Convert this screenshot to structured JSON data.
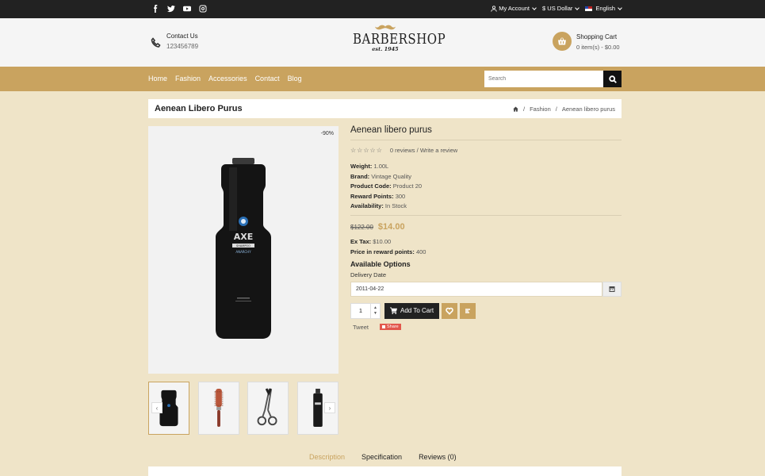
{
  "topbar": {
    "social_icons": [
      "facebook-icon",
      "twitter-icon",
      "youtube-icon",
      "instagram-icon"
    ],
    "my_account": "My Account",
    "currency": "$ US Dollar",
    "language": "English"
  },
  "header": {
    "contact_title": "Contact Us",
    "contact_phone": "123456789",
    "logo_name": "BARBERSHOP",
    "logo_est": "est. 1945",
    "cart_title": "Shopping Cart",
    "cart_summary": "0 item(s) - $0.00"
  },
  "nav": {
    "items": [
      "Home",
      "Fashion",
      "Accessories",
      "Contact",
      "Blog"
    ],
    "search_placeholder": "Search"
  },
  "breadcrumb": {
    "page_title": "Aenean Libero Purus",
    "items": [
      "Fashion",
      "Aenean libero purus"
    ]
  },
  "product": {
    "discount_badge": "-90%",
    "name": "Aenean libero purus",
    "reviews_link": "0 reviews",
    "write_review": "Write a review",
    "specs": [
      {
        "label": "Weight:",
        "value": "1.00L"
      },
      {
        "label": "Brand:",
        "value": "Vintage Quality"
      },
      {
        "label": "Product Code:",
        "value": "Product 20"
      },
      {
        "label": "Reward Points:",
        "value": "300"
      },
      {
        "label": "Availability:",
        "value": "In Stock"
      }
    ],
    "old_price": "$122.00",
    "new_price": "$14.00",
    "ex_tax_label": "Ex Tax:",
    "ex_tax_value": "$10.00",
    "reward_price_label": "Price in reward points:",
    "reward_price_value": "400",
    "options_title": "Available Options",
    "delivery_label": "Delivery Date",
    "delivery_value": "2011-04-22",
    "quantity": "1",
    "add_to_cart": "Add To Cart",
    "tweet": "Tweet",
    "share": "Share",
    "bottle_brand": "AXE",
    "bottle_sub": "SHAMPOO",
    "bottle_line": "ANARCHY"
  },
  "tabs": [
    "Description",
    "Specification",
    "Reviews (0)"
  ],
  "colors": {
    "accent": "#c9a35f",
    "background": "#efe4c8",
    "dark": "#222222"
  }
}
